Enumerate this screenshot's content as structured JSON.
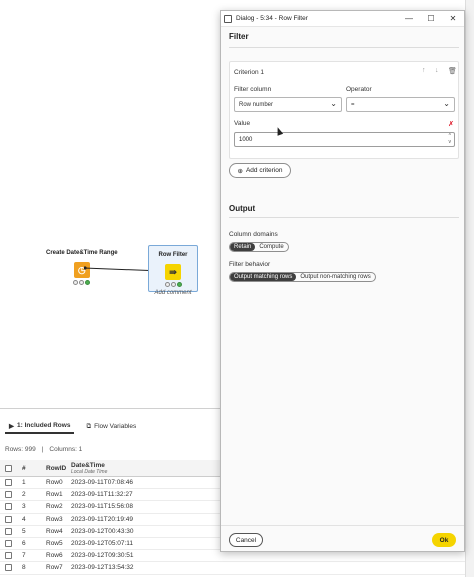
{
  "canvas": {
    "node1": {
      "title": "Create Date&Time Range"
    },
    "node2": {
      "title": "Row Filter",
      "add_comment": "Add comment"
    }
  },
  "bottom_panel": {
    "tabs": [
      {
        "label": "1: Included Rows",
        "active": true
      },
      {
        "label": "Flow Variables",
        "active": false
      }
    ],
    "rows_info": "Rows: 999",
    "columns_info": "Columns: 1",
    "table": {
      "headers": {
        "index": "#",
        "rowid": "RowID",
        "datetime": "Date&Time",
        "datetime_type": "Local Date Time"
      },
      "rows": [
        {
          "index": "1",
          "rowid": "Row0",
          "datetime": "2023-09-11T07:08:46"
        },
        {
          "index": "2",
          "rowid": "Row1",
          "datetime": "2023-09-11T11:32:27"
        },
        {
          "index": "3",
          "rowid": "Row2",
          "datetime": "2023-09-11T15:56:08"
        },
        {
          "index": "4",
          "rowid": "Row3",
          "datetime": "2023-09-11T20:19:49"
        },
        {
          "index": "5",
          "rowid": "Row4",
          "datetime": "2023-09-12T00:43:30"
        },
        {
          "index": "6",
          "rowid": "Row5",
          "datetime": "2023-09-12T05:07:11"
        },
        {
          "index": "7",
          "rowid": "Row6",
          "datetime": "2023-09-12T09:30:51"
        },
        {
          "index": "8",
          "rowid": "Row7",
          "datetime": "2023-09-12T13:54:32"
        }
      ]
    }
  },
  "dialog": {
    "title": "Dialog - 5:34 - Row Filter",
    "filter_section": "Filter",
    "criterion": {
      "name": "Criterion 1",
      "filter_column_label": "Filter column",
      "filter_column_value": "Row number",
      "operator_label": "Operator",
      "operator_value": "=",
      "value_label": "Value",
      "value": "1000"
    },
    "add_criterion": "Add criterion",
    "output_section": "Output",
    "column_domains_label": "Column domains",
    "column_domains_options": [
      {
        "label": "Retain",
        "selected": true
      },
      {
        "label": "Compute",
        "selected": false
      }
    ],
    "filter_behavior_label": "Filter behavior",
    "filter_behavior_options": [
      {
        "label": "Output matching rows",
        "selected": true
      },
      {
        "label": "Output non-matching rows",
        "selected": false
      }
    ],
    "cancel_label": "Cancel",
    "ok_label": "Ok"
  },
  "colors": {
    "accent_yellow": "#f5d400",
    "node_orange": "#f0a020",
    "node_yellow": "#f5d400",
    "delete_red": "#d12222"
  }
}
